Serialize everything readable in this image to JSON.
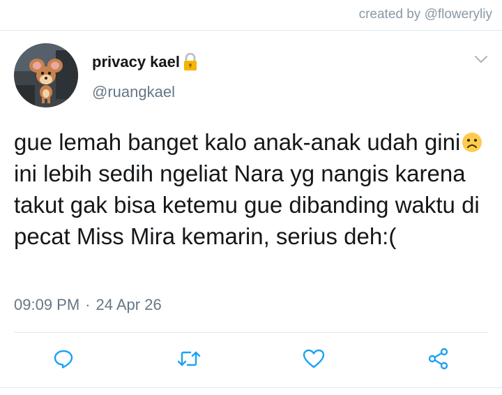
{
  "credit": "created by @floweryliy",
  "tweet": {
    "display_name": "privacy kael",
    "handle": "@ruangkael",
    "text_part1": "gue lemah banget kalo anak-anak udah gini",
    "text_part2": " ini lebih sedih ngeliat Nara yg nangis karena takut gak bisa ketemu gue dibanding waktu di pecat Miss Mira kemarin, serius deh:(",
    "time": "09:09 PM",
    "separator": "·",
    "date": "24 Apr 26"
  },
  "icons": {
    "lock": "lock-icon",
    "sad_face": "sad-face-emoji",
    "more": "chevron-down-icon",
    "reply": "reply-icon",
    "retweet": "retweet-icon",
    "like": "heart-icon",
    "share": "share-icon"
  },
  "colors": {
    "text": "#14171a",
    "secondary": "#657786",
    "credit": "#8899a6",
    "action_icon": "#1da1f2",
    "divider": "#e1e8ed",
    "lock": "#f5b400"
  }
}
